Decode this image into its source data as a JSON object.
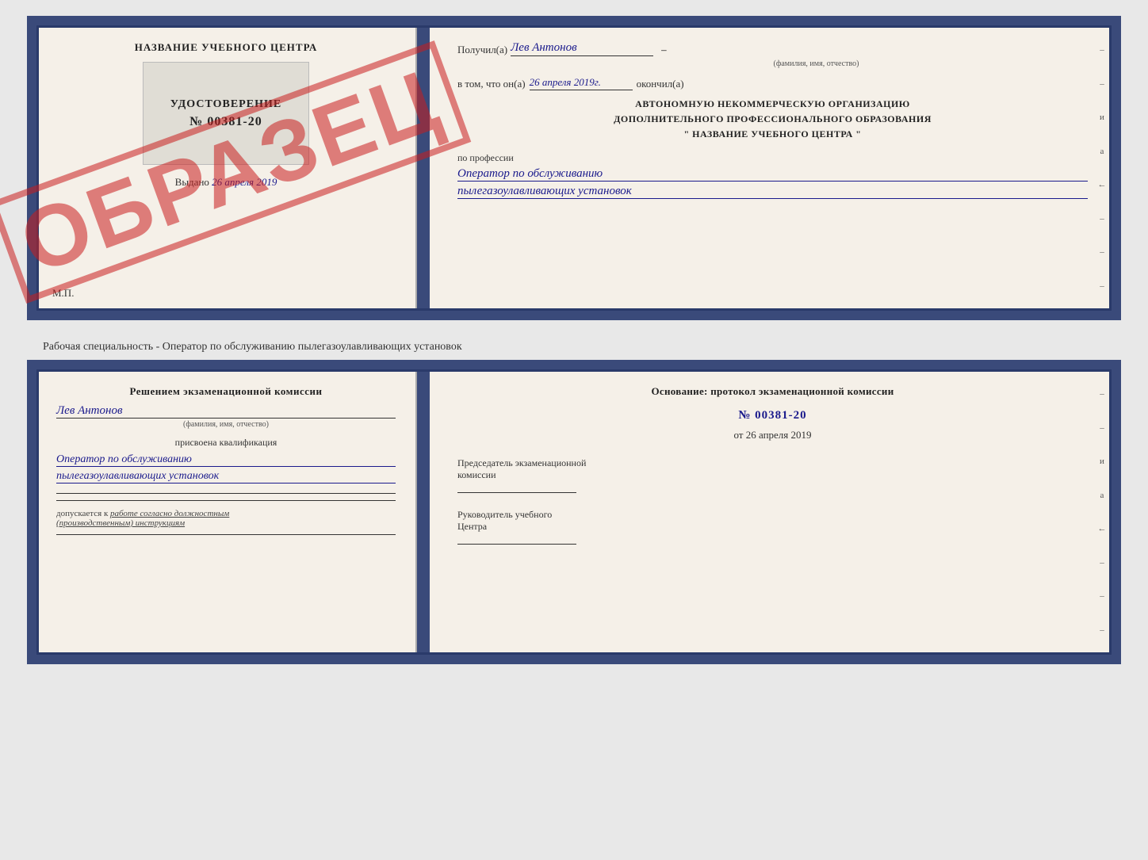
{
  "top": {
    "left": {
      "center_title": "НАЗВАНИЕ УЧЕБНОГО ЦЕНТРА",
      "udost_label": "УДОСТОВЕРЕНИЕ",
      "udost_number": "№ 00381-20",
      "vydano": "Выдано",
      "vydano_date": "26 апреля 2019",
      "mp": "М.П.",
      "stamp": "ОБРАЗЕЦ"
    },
    "right": {
      "poluchil_label": "Получил(а)",
      "poluchil_name": "Лев Антонов",
      "fio_hint": "(фамилия, имя, отчество)",
      "vtom_label": "в том, что он(а)",
      "vtom_date": "26 апреля 2019г.",
      "okonchil": "окончил(а)",
      "org_line1": "АВТОНОМНУЮ НЕКОММЕРЧЕСКУЮ ОРГАНИЗАЦИЮ",
      "org_line2": "ДОПОЛНИТЕЛЬНОГО ПРОФЕССИОНАЛЬНОГО ОБРАЗОВАНИЯ",
      "org_line3": "\" НАЗВАНИЕ УЧЕБНОГО ЦЕНТРА \"",
      "po_professii": "по профессии",
      "profession1": "Оператор по обслуживанию",
      "profession2": "пылегазоулавливающих установок"
    }
  },
  "middle_label": "Рабочая специальность - Оператор по обслуживанию пылегазоулавливающих установок",
  "bottom": {
    "left": {
      "resheniem": "Решением экзаменационной комиссии",
      "name": "Лев Антонов",
      "fio_hint": "(фамилия, имя, отчество)",
      "prisvoena": "присвоена квалификация",
      "qual1": "Оператор по обслуживанию",
      "qual2": "пылегазоулавливающих установок",
      "dopuskaetsya_prefix": "допускается к",
      "dopuskaetsya_text": "работе согласно должностным",
      "dopuskaetsya_text2": "(производственным) инструкциям"
    },
    "right": {
      "osnovanie": "Основание: протокол экзаменационной комиссии",
      "prot_number": "№ 00381-20",
      "prot_date_prefix": "от",
      "prot_date": "26 апреля 2019",
      "predsedatel_label": "Председатель экзаменационной",
      "predsedatel_label2": "комиссии",
      "rukovoditel_label": "Руководитель учебного",
      "rukovoditel_label2": "Центра"
    }
  },
  "side_marks": [
    "-",
    "и",
    "а",
    "←",
    "-",
    "-",
    "-"
  ]
}
